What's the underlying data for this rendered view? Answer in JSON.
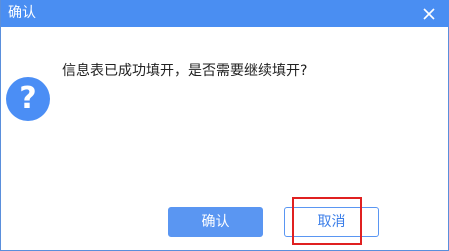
{
  "dialog": {
    "title": "确认",
    "close_icon": "close-icon",
    "icon": "question-icon",
    "icon_glyph": "?",
    "message": "信息表已成功填开，是否需要继续填开?",
    "buttons": {
      "confirm_label": "确认",
      "cancel_label": "取消"
    }
  },
  "colors": {
    "titlebar": "#4a8ef2",
    "accent": "#5a96f2",
    "highlight": "#e02020"
  }
}
